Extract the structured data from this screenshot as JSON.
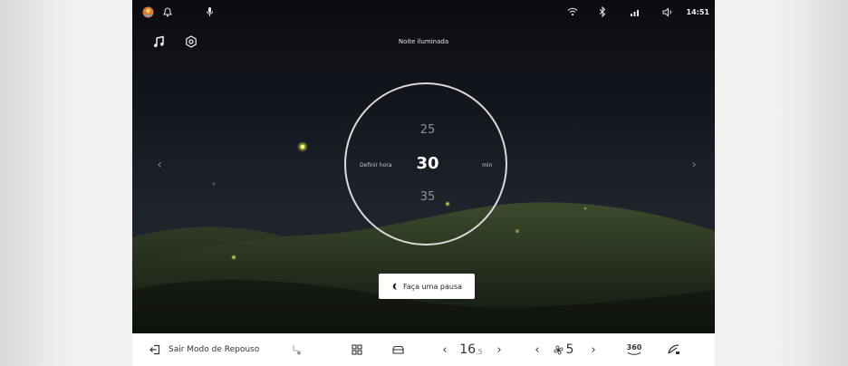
{
  "status_bar": {
    "time": "14:51",
    "icons": [
      "avatar-icon",
      "bell-icon",
      "microphone-icon",
      "wifi-icon",
      "bluetooth-icon",
      "cellular-signal-icon",
      "volume-icon"
    ]
  },
  "header": {
    "title": "Noite iluminada",
    "left_icons": [
      "music-note-icon",
      "settings-icon"
    ]
  },
  "timer": {
    "label": "Definir hora",
    "prev_value": "25",
    "current_value": "30",
    "next_value": "35",
    "unit": "min"
  },
  "action": {
    "pause_label": "Faça uma pausa"
  },
  "bottom_bar": {
    "exit_label": "Sair Modo de Repouso",
    "temperature_value": "16",
    "temperature_decimal": ".5",
    "fan_level": "5",
    "camera_label": "360"
  }
}
